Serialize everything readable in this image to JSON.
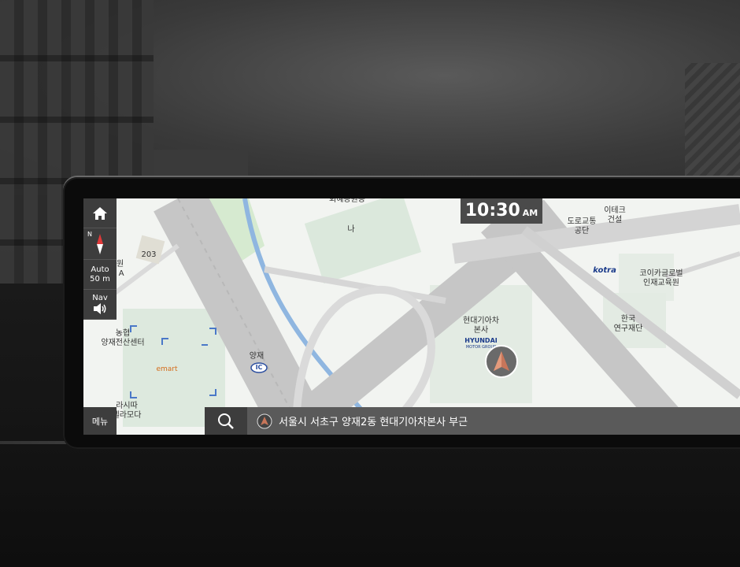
{
  "clock": {
    "time": "10:30",
    "ampm": "AM"
  },
  "controls": {
    "compass_label": "N",
    "scale_mode": "Auto",
    "scale_value": "50 m",
    "sound_label": "Nav",
    "menu_label": "메뉴"
  },
  "search_bar": {
    "address": "서울시 서초구 양재2동 현대기아차본사 부근"
  },
  "map_labels": {
    "top_cut": "회혜공원등",
    "na": "나",
    "bldg_203": "203",
    "park_cut": "공원\n타 A",
    "nonghyup": "농협\n양재전산센터",
    "emart": "emart",
    "rasitta": "라시따\n델라모다",
    "yangjae": "양재",
    "ic": "IC",
    "hyundai_hq": "현대기아차\n본사",
    "hyundai_logo": "HYUNDAI",
    "hyundai_group": "MOTOR GROUP",
    "road_corp": "도로교통\n공단",
    "itech": "이테크\n건설",
    "kotra": "kotra",
    "korea_global": "코이카글로벌\n인재교육원",
    "korea_research": "한국\n연구재단"
  },
  "colors": {
    "panel": "#3d3d3d",
    "map_bg": "#f2f4f1",
    "road": "#c8c8c8",
    "river": "#8fb6e0",
    "green": "#d9e9d9",
    "marker": "#c8765a"
  }
}
